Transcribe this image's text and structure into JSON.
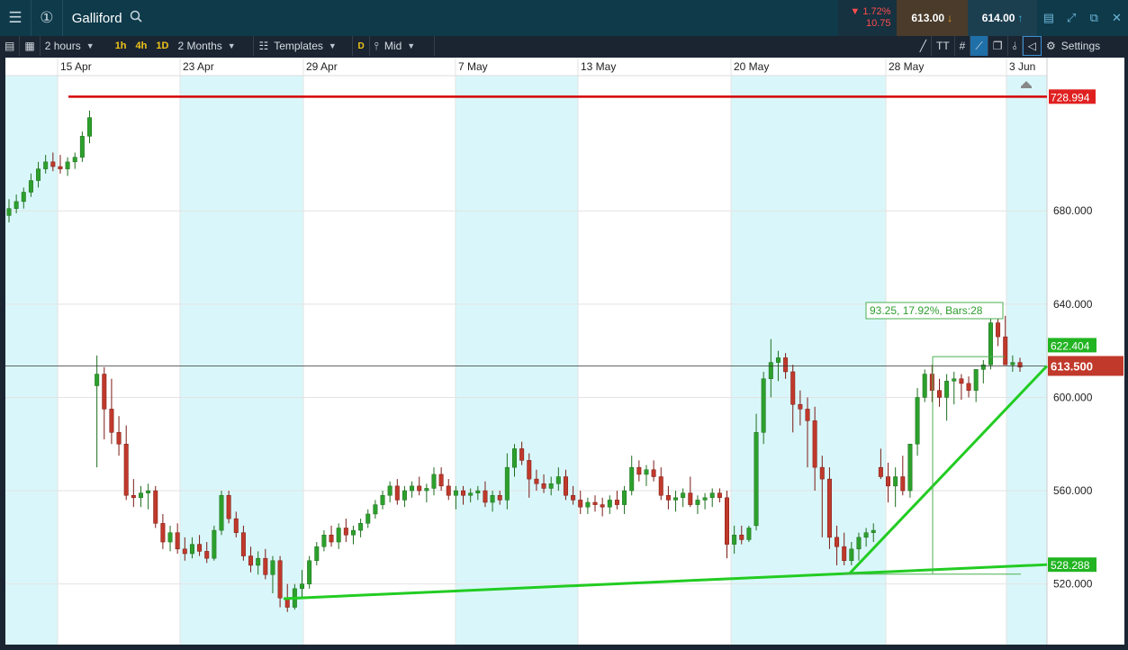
{
  "toolbar_top": {
    "instrument": "Galliford",
    "change_pct": "▼ 1.72%",
    "change_abs": "10.75",
    "sell_price": "613.00",
    "buy_price": "614.00"
  },
  "toolbar": {
    "interval": "2 hours",
    "quick_1h": "1h",
    "quick_4h": "4h",
    "quick_1d": "1D",
    "range": "2 Months",
    "templates": "Templates",
    "d_button": "D",
    "price_type": "Mid",
    "text_tool": "TT",
    "settings": "Settings"
  },
  "colors": {
    "up": "#2ca02c",
    "down": "#c0392b",
    "shade": "#d9f7fa",
    "red_line": "#d40000",
    "green_line": "#22cc22",
    "price_label_bg": "#c0392b"
  },
  "chart_data": {
    "type": "candlestick",
    "x_labels": [
      "15 Apr",
      "23 Apr",
      "29 Apr",
      "7 May",
      "13 May",
      "20 May",
      "28 May",
      "3 Jun"
    ],
    "y_ticks": [
      "520.000",
      "560.000",
      "600.000",
      "640.000",
      "680.000"
    ],
    "ylim": [
      494,
      738
    ],
    "horizontal_line": {
      "value": 728.994,
      "label": "728.994"
    },
    "current_price": {
      "value": 613.5,
      "label": "613.500"
    },
    "trendline_labels": [
      {
        "value": 622.404,
        "label": "622.404"
      },
      {
        "value": 528.288,
        "label": "528.288"
      }
    ],
    "measure_label": "93.25, 17.92%, Bars:28",
    "candles": [
      [
        678,
        685,
        675,
        681
      ],
      [
        681,
        687,
        679,
        684
      ],
      [
        684,
        690,
        681,
        688
      ],
      [
        688,
        696,
        686,
        693
      ],
      [
        693,
        701,
        690,
        698
      ],
      [
        698,
        704,
        696,
        701
      ],
      [
        701,
        705,
        697,
        699
      ],
      [
        699,
        704,
        696,
        698
      ],
      [
        698,
        703,
        695,
        701
      ],
      [
        701,
        705,
        698,
        703
      ],
      [
        703,
        714,
        701,
        712
      ],
      [
        712,
        723,
        709,
        720
      ],
      [
        605,
        618,
        570,
        610
      ],
      [
        610,
        613,
        582,
        595
      ],
      [
        595,
        608,
        580,
        585
      ],
      [
        585,
        592,
        575,
        580
      ],
      [
        580,
        588,
        556,
        558
      ],
      [
        558,
        565,
        553,
        557
      ],
      [
        557,
        562,
        553,
        559
      ],
      [
        559,
        563,
        552,
        560
      ],
      [
        560,
        562,
        544,
        546
      ],
      [
        546,
        550,
        535,
        538
      ],
      [
        538,
        545,
        534,
        542
      ],
      [
        542,
        546,
        533,
        535
      ],
      [
        535,
        540,
        530,
        533
      ],
      [
        533,
        540,
        531,
        537
      ],
      [
        537,
        541,
        532,
        534
      ],
      [
        534,
        538,
        529,
        531
      ],
      [
        531,
        545,
        530,
        543
      ],
      [
        543,
        560,
        541,
        558
      ],
      [
        558,
        560,
        546,
        548
      ],
      [
        548,
        551,
        540,
        542
      ],
      [
        542,
        545,
        530,
        532
      ],
      [
        532,
        536,
        525,
        528
      ],
      [
        528,
        534,
        524,
        531
      ],
      [
        531,
        535,
        522,
        524
      ],
      [
        524,
        532,
        516,
        530
      ],
      [
        530,
        532,
        510,
        514
      ],
      [
        514,
        520,
        508,
        510
      ],
      [
        510,
        520,
        509,
        518
      ],
      [
        518,
        526,
        514,
        520
      ],
      [
        520,
        532,
        518,
        530
      ],
      [
        530,
        538,
        528,
        536
      ],
      [
        536,
        543,
        534,
        541
      ],
      [
        541,
        545,
        536,
        538
      ],
      [
        538,
        546,
        535,
        544
      ],
      [
        544,
        548,
        538,
        541
      ],
      [
        541,
        545,
        537,
        543
      ],
      [
        543,
        548,
        540,
        546
      ],
      [
        546,
        552,
        544,
        550
      ],
      [
        550,
        556,
        548,
        554
      ],
      [
        554,
        560,
        552,
        558
      ],
      [
        558,
        564,
        555,
        562
      ],
      [
        562,
        565,
        554,
        556
      ],
      [
        556,
        562,
        553,
        560
      ],
      [
        560,
        564,
        557,
        562
      ],
      [
        562,
        566,
        558,
        560
      ],
      [
        560,
        563,
        555,
        561
      ],
      [
        561,
        570,
        558,
        567
      ],
      [
        567,
        570,
        560,
        562
      ],
      [
        562,
        565,
        556,
        558
      ],
      [
        558,
        562,
        552,
        560
      ],
      [
        560,
        562,
        554,
        558
      ],
      [
        558,
        561,
        555,
        559
      ],
      [
        559,
        562,
        556,
        560
      ],
      [
        560,
        564,
        553,
        555
      ],
      [
        555,
        560,
        551,
        558
      ],
      [
        558,
        560,
        554,
        556
      ],
      [
        556,
        576,
        552,
        570
      ],
      [
        570,
        580,
        566,
        578
      ],
      [
        578,
        581,
        571,
        573
      ],
      [
        573,
        576,
        557,
        565
      ],
      [
        565,
        569,
        560,
        563
      ],
      [
        563,
        567,
        559,
        561
      ],
      [
        561,
        566,
        558,
        563
      ],
      [
        563,
        570,
        560,
        566
      ],
      [
        566,
        569,
        556,
        558
      ],
      [
        558,
        562,
        554,
        556
      ],
      [
        556,
        560,
        550,
        553
      ],
      [
        553,
        557,
        550,
        555
      ],
      [
        555,
        558,
        551,
        554
      ],
      [
        554,
        557,
        549,
        553
      ],
      [
        553,
        558,
        550,
        556
      ],
      [
        556,
        560,
        552,
        554
      ],
      [
        554,
        562,
        550,
        560
      ],
      [
        560,
        575,
        558,
        570
      ],
      [
        570,
        573,
        564,
        567
      ],
      [
        567,
        571,
        562,
        569
      ],
      [
        569,
        573,
        564,
        566
      ],
      [
        566,
        570,
        556,
        558
      ],
      [
        558,
        562,
        552,
        556
      ],
      [
        556,
        560,
        551,
        557
      ],
      [
        557,
        561,
        553,
        559
      ],
      [
        559,
        566,
        553,
        554
      ],
      [
        554,
        558,
        550,
        556
      ],
      [
        556,
        559,
        552,
        557
      ],
      [
        557,
        561,
        553,
        559
      ],
      [
        559,
        561,
        555,
        557
      ],
      [
        557,
        560,
        531,
        537
      ],
      [
        537,
        545,
        533,
        541
      ],
      [
        541,
        545,
        537,
        539
      ],
      [
        539,
        545,
        538,
        544
      ],
      [
        545,
        593,
        543,
        585
      ],
      [
        585,
        611,
        580,
        608
      ],
      [
        608,
        625,
        600,
        615
      ],
      [
        615,
        620,
        607,
        617
      ],
      [
        617,
        619,
        608,
        611
      ],
      [
        611,
        614,
        585,
        597
      ],
      [
        597,
        603,
        588,
        595
      ],
      [
        595,
        600,
        570,
        590
      ],
      [
        590,
        596,
        560,
        570
      ],
      [
        570,
        575,
        540,
        565
      ],
      [
        565,
        570,
        535,
        540
      ],
      [
        540,
        545,
        528,
        536
      ],
      [
        536,
        542,
        528,
        530
      ],
      [
        530,
        538,
        528,
        535
      ],
      [
        535,
        542,
        530,
        540
      ],
      [
        540,
        544,
        536,
        542
      ],
      [
        542,
        546,
        538,
        543
      ],
      [
        570,
        578,
        565,
        566
      ],
      [
        566,
        572,
        555,
        562
      ],
      [
        562,
        570,
        553,
        566
      ],
      [
        566,
        575,
        558,
        560
      ],
      [
        560,
        580,
        557,
        580
      ],
      [
        580,
        604,
        575,
        600
      ],
      [
        600,
        612,
        598,
        610
      ],
      [
        610,
        614,
        598,
        603
      ],
      [
        603,
        608,
        596,
        600
      ],
      [
        600,
        610,
        590,
        607
      ],
      [
        607,
        611,
        597,
        608
      ],
      [
        608,
        610,
        599,
        606
      ],
      [
        606,
        609,
        600,
        603
      ],
      [
        603,
        612,
        598,
        612
      ],
      [
        612,
        616,
        606,
        614
      ],
      [
        614,
        634,
        612,
        632
      ],
      [
        632,
        634,
        622,
        626
      ],
      [
        626,
        635,
        616,
        614
      ],
      [
        614,
        618,
        611,
        615
      ],
      [
        615,
        617,
        611,
        613
      ]
    ]
  }
}
